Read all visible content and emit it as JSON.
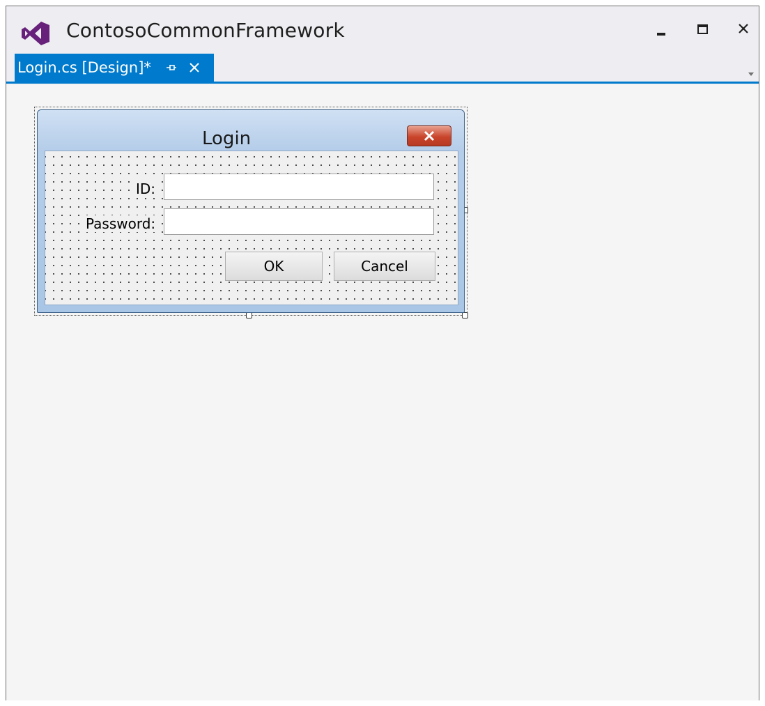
{
  "app": {
    "title": "ContosoCommonFramework",
    "icon": "visual-studio-logo",
    "accent_color": "#68217a"
  },
  "window_controls": {
    "minimize_icon": "minimize-icon",
    "maximize_icon": "maximize-icon",
    "close_icon": "close-icon"
  },
  "tabs": [
    {
      "label": "Login.cs [Design]*",
      "active": true,
      "pin_icon": "pin-icon",
      "close_icon": "close-icon",
      "color": "#007acc"
    }
  ],
  "designer": {
    "form": {
      "title": "Login",
      "close_icon": "close-icon",
      "fields": [
        {
          "label": "ID:",
          "value": ""
        },
        {
          "label": "Password:",
          "value": ""
        }
      ],
      "buttons": {
        "ok": "OK",
        "cancel": "Cancel"
      }
    }
  }
}
